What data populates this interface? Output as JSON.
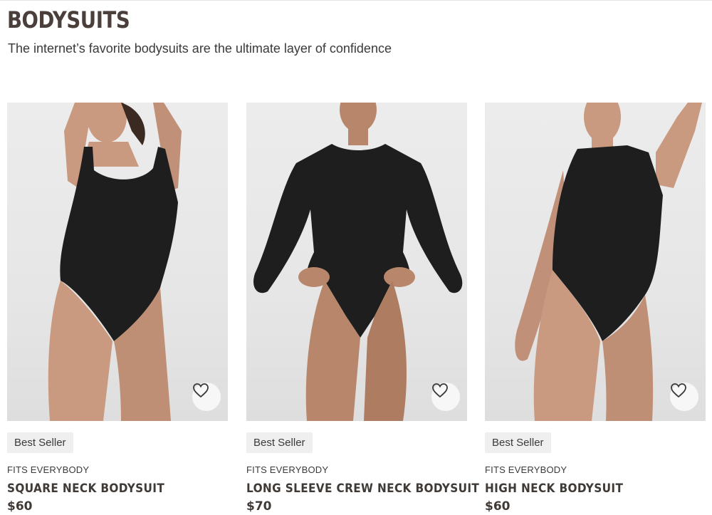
{
  "header": {
    "title": "BODYSUITS",
    "subtitle": "The internet’s favorite bodysuits are the ultimate layer of confidence"
  },
  "products": [
    {
      "badge": "Best Seller",
      "brand": "FITS EVERYBODY",
      "name": "SQUARE NECK BODYSUIT",
      "price": "$60",
      "wishlist_icon": "heart-outline-icon"
    },
    {
      "badge": "Best Seller",
      "brand": "FITS EVERYBODY",
      "name": "LONG SLEEVE CREW NECK BODYSUIT",
      "price": "$70",
      "wishlist_icon": "heart-outline-icon"
    },
    {
      "badge": "Best Seller",
      "brand": "FITS EVERYBODY",
      "name": "HIGH NECK BODYSUIT",
      "price": "$60",
      "wishlist_icon": "heart-outline-icon"
    }
  ],
  "colors": {
    "text": "#3f3a36",
    "badge_bg": "#efefef",
    "photo_bg": "#e7e7e7",
    "garment": "#1e1e1e",
    "skin": "#c99a80"
  }
}
